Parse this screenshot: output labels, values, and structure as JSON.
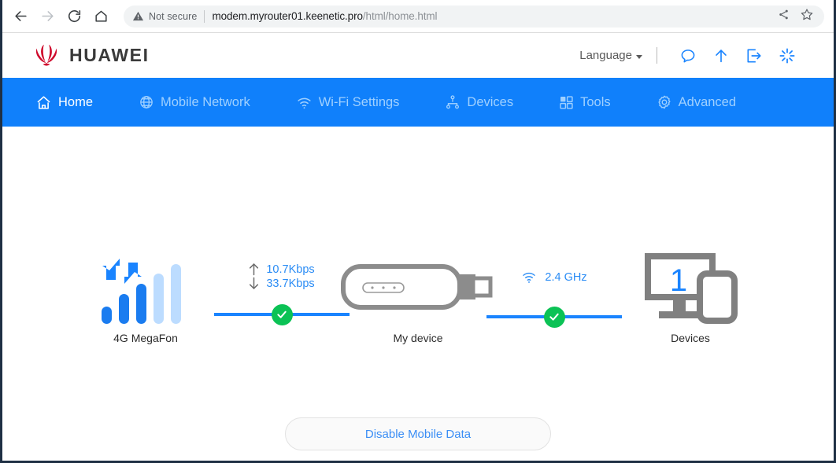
{
  "browser": {
    "back_icon": "arrow-left-icon",
    "forward_icon": "arrow-right-icon",
    "reload_icon": "reload-icon",
    "home_icon": "home-icon",
    "security_icon": "warning-triangle-icon",
    "security_label": "Not secure",
    "url_host": "modem.myrouter01.keenetic.pro",
    "url_path": "/html/home.html",
    "share_icon": "share-icon",
    "bookmark_icon": "star-icon"
  },
  "header": {
    "brand": "HUAWEI",
    "brand_color": "#cf0a2c",
    "language_label": "Language",
    "icons": [
      {
        "name": "sms-bubble-icon",
        "title": "SMS"
      },
      {
        "name": "upload-arrow-icon",
        "title": "Update"
      },
      {
        "name": "logout-icon",
        "title": "Log out"
      },
      {
        "name": "reboot-icon",
        "title": "Reboot"
      }
    ]
  },
  "nav": {
    "accent": "#1080fb",
    "items": [
      {
        "label": "Home",
        "icon": "home-icon",
        "active": true
      },
      {
        "label": "Mobile Network",
        "icon": "globe-icon",
        "active": false
      },
      {
        "label": "Wi-Fi Settings",
        "icon": "wifi-icon",
        "active": false
      },
      {
        "label": "Devices",
        "icon": "network-tree-icon",
        "active": false
      },
      {
        "label": "Tools",
        "icon": "grid-icon",
        "active": false
      },
      {
        "label": "Advanced",
        "icon": "gear-icon",
        "active": false
      }
    ]
  },
  "topology": {
    "signal": {
      "icon": "signal-bars-icon",
      "bars_total": 5,
      "bars_active": 3,
      "network_type": "4G",
      "operator": "MegaFon",
      "label": "4G  MegaFon"
    },
    "wan_link": {
      "upload_icon": "arrow-up-icon",
      "upload_speed": "10.7Kbps",
      "download_icon": "arrow-down-icon",
      "download_speed": "33.7Kbps",
      "status_icon": "check-circle-icon",
      "status_color": "#0bc255",
      "line_color": "#1a84ff"
    },
    "device": {
      "icon": "usb-modem-icon",
      "label": "My device"
    },
    "lan_link": {
      "icon": "wifi-icon",
      "band": "2.4 GHz",
      "status_icon": "check-circle-icon",
      "status_color": "#0bc255",
      "line_color": "#1a84ff"
    },
    "clients": {
      "icon": "monitor-phone-icon",
      "count": "1",
      "label": "Devices"
    }
  },
  "actions": {
    "mobile_data_button": "Disable Mobile Data"
  }
}
